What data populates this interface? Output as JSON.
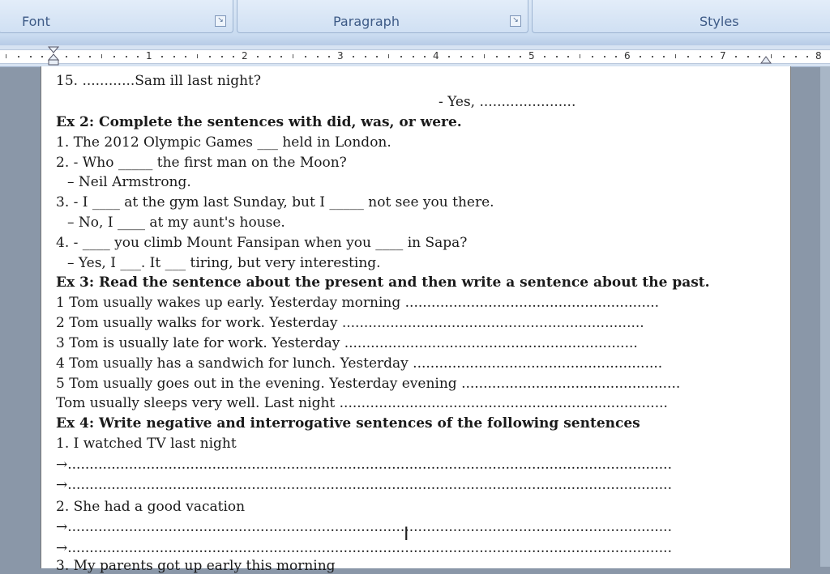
{
  "ribbon": {
    "groups": [
      {
        "label": "Font"
      },
      {
        "label": "Paragraph"
      },
      {
        "label": "Styles"
      }
    ],
    "launcher_icon": "dialog-launcher-icon"
  },
  "ruler": {
    "numbers": [
      "1",
      "2",
      "3",
      "4",
      "5",
      "6",
      "7",
      "8"
    ]
  },
  "document": {
    "lines": [
      {
        "text": "15. ............Sam ill last night?",
        "bold": false
      },
      {
        "text": "- Yes, ......................",
        "bold": false
      },
      {
        "text": "Ex 2: Complete the sentences with did, was, or were.",
        "bold": true
      },
      {
        "text": "1. The 2012 Olympic Games ___ held in London.",
        "bold": false
      },
      {
        "text": "2. - Who _____ the first man on the Moon?",
        "bold": false
      },
      {
        "text": "– Neil Armstrong.",
        "bold": false
      },
      {
        "text": "3. - I ____ at the gym last Sunday, but I _____ not see you there.",
        "bold": false
      },
      {
        "text": "– No, I ____ at my aunt's house.",
        "bold": false
      },
      {
        "text": "4. - ____ you climb Mount Fansipan when you ____ in Sapa?",
        "bold": false
      },
      {
        "text": "– Yes, I ___. It ___ tiring, but very interesting.",
        "bold": false
      },
      {
        "text": "Ex 3: Read the sentence about the present and then write a sentence about the past.",
        "bold": true
      },
      {
        "text": "1 Tom usually wakes up early. Yesterday morning ..........................................................",
        "bold": false
      },
      {
        "text": "2 Tom usually walks for work. Yesterday .....................................................................",
        "bold": false
      },
      {
        "text": "3 Tom is usually late for work. Yesterday ...................................................................",
        "bold": false
      },
      {
        "text": "4 Tom usually has a sandwich for lunch. Yesterday .........................................................",
        "bold": false
      },
      {
        "text": "5 Tom usually goes out in the evening. Yesterday evening ..................................................",
        "bold": false
      },
      {
        "text": "Tom usually sleeps very well. Last night ...........................................................................",
        "bold": false
      },
      {
        "text": "Ex 4: Write negative and interrogative sentences of the following sentences",
        "bold": true
      },
      {
        "text": "1. I watched TV last night",
        "bold": false
      },
      {
        "text": "→..........................................................................................................................................",
        "bold": false
      },
      {
        "text": "→..........................................................................................................................................",
        "bold": false
      },
      {
        "text": "2. She had a good vacation",
        "bold": false
      },
      {
        "text": "→..........................................................................................................................................",
        "bold": false
      },
      {
        "text": "→..........................................................................................................................................",
        "bold": false
      },
      {
        "text": "3. My parents got up early this morning",
        "bold": false
      }
    ],
    "cursor_icon": "text-cursor-icon",
    "cursor_glyph": "I"
  }
}
